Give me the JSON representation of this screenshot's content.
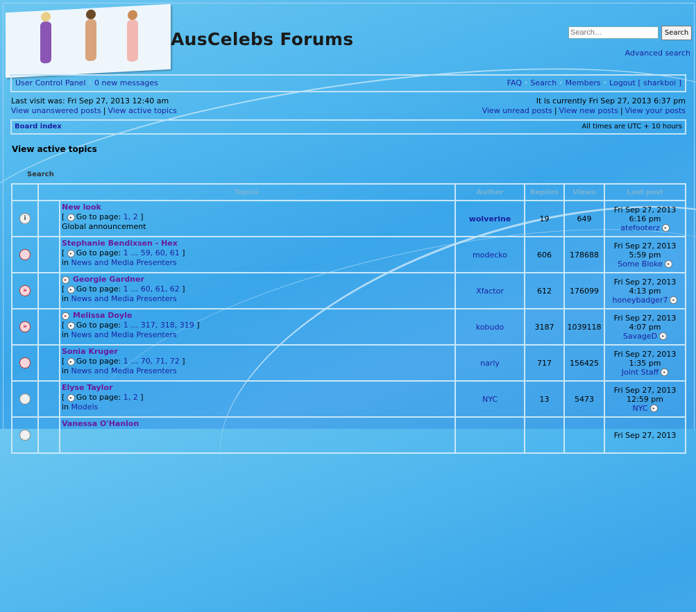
{
  "header": {
    "site_title": "AusCelebs Forums",
    "search_placeholder": "Search…",
    "search_button": "Search",
    "advanced_search": "Advanced search"
  },
  "navbar": {
    "ucp": "User Control Panel",
    "new_messages": "0 new messages",
    "faq": "FAQ",
    "search": "Search",
    "members": "Members",
    "logout": "Logout [ sharkboi ]"
  },
  "visit": {
    "last_visit": "Last visit was: Fri Sep 27, 2013 12:40 am",
    "unanswered": "View unanswered posts",
    "active": "View active topics",
    "current_time": "It is currently Fri Sep 27, 2013 6:37 pm",
    "unread": "View unread posts",
    "new_posts": "View new posts",
    "your_posts": "View your posts"
  },
  "breadcrumb": {
    "board_index": "Board index",
    "timezone": "All times are UTC + 10 hours"
  },
  "page": {
    "heading": "View active topics",
    "search_label": "Search"
  },
  "table": {
    "headers": {
      "topics": "Topics",
      "author": "Author",
      "replies": "Replies",
      "views": "Views",
      "last_post": "Last post"
    },
    "goto_label": "Go to page:",
    "rows": [
      {
        "icon": "announcement-icon",
        "title": "New look",
        "pages": "1, 2",
        "forum_prefix": "",
        "forum": "Global announcement",
        "author": "wolverine",
        "author_bold": true,
        "replies": "19",
        "views": "649",
        "last_date": "Fri Sep 27, 2013",
        "last_time": "6:16 pm",
        "last_user": "atefooterz",
        "new": false
      },
      {
        "icon": "topic-read-hot-icon",
        "title": "Stephanie Bendixsen - Hex",
        "pages": "1 … 59, 60, 61",
        "forum_prefix": "in",
        "forum": "News and Media Presenters",
        "author": "modecko",
        "author_bold": false,
        "replies": "606",
        "views": "178688",
        "last_date": "Fri Sep 27, 2013",
        "last_time": "5:59 pm",
        "last_user": "Some Bloke",
        "new": false
      },
      {
        "icon": "topic-unread-hot-icon",
        "title": "Georgie Gardner",
        "pages": "1 … 60, 61, 62",
        "forum_prefix": "in",
        "forum": "News and Media Presenters",
        "author": "Xfactor",
        "author_bold": false,
        "replies": "612",
        "views": "176099",
        "last_date": "Fri Sep 27, 2013",
        "last_time": "4:13 pm",
        "last_user": "honeybadger7",
        "new": true
      },
      {
        "icon": "topic-unread-hot-icon",
        "title": "Melissa Doyle",
        "pages": "1 … 317, 318, 319",
        "forum_prefix": "in",
        "forum": "News and Media Presenters",
        "author": "kobudo",
        "author_bold": false,
        "replies": "3187",
        "views": "1039118",
        "last_date": "Fri Sep 27, 2013",
        "last_time": "4:07 pm",
        "last_user": "SavageD",
        "new": true
      },
      {
        "icon": "topic-read-hot-icon",
        "title": "Sonia Kruger",
        "pages": "1 … 70, 71, 72",
        "forum_prefix": "in",
        "forum": "News and Media Presenters",
        "author": "narly",
        "author_bold": false,
        "replies": "717",
        "views": "156425",
        "last_date": "Fri Sep 27, 2013",
        "last_time": "1:35 pm",
        "last_user": "Joint Staff",
        "new": false
      },
      {
        "icon": "topic-read-icon",
        "title": "Elyse Taylor",
        "pages": "1, 2",
        "forum_prefix": "in",
        "forum": "Models",
        "author": "NYC",
        "author_bold": false,
        "replies": "13",
        "views": "5473",
        "last_date": "Fri Sep 27, 2013",
        "last_time": "12:59 pm",
        "last_user": "NYC",
        "new": false
      },
      {
        "icon": "topic-read-icon",
        "title": "Vanessa O'Hanlon",
        "pages": "",
        "forum_prefix": "",
        "forum": "",
        "author": "",
        "author_bold": false,
        "replies": "",
        "views": "",
        "last_date": "Fri Sep 27, 2013",
        "last_time": "",
        "last_user": "",
        "new": false
      }
    ]
  }
}
